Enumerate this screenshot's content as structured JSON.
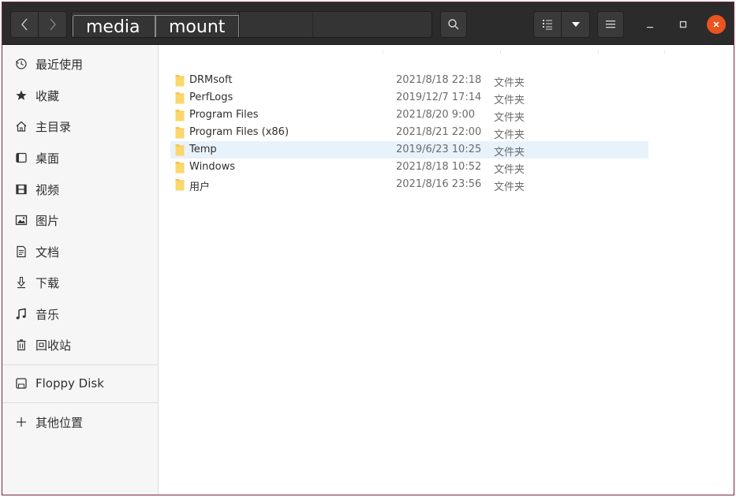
{
  "path": {
    "crumbs": [
      "media",
      "mount"
    ]
  },
  "sidebar": {
    "places": [
      {
        "label": "最近使用",
        "icon": "clock-icon"
      },
      {
        "label": "收藏",
        "icon": "star-icon"
      },
      {
        "label": "主目录",
        "icon": "home-icon"
      },
      {
        "label": "桌面",
        "icon": "desktop-icon"
      },
      {
        "label": "视频",
        "icon": "video-icon"
      },
      {
        "label": "图片",
        "icon": "image-icon"
      },
      {
        "label": "文档",
        "icon": "document-icon"
      },
      {
        "label": "下载",
        "icon": "download-icon"
      },
      {
        "label": "音乐",
        "icon": "music-icon"
      },
      {
        "label": "回收站",
        "icon": "trash-icon"
      }
    ],
    "devices": [
      {
        "label": "Floppy Disk",
        "icon": "floppy-icon"
      }
    ],
    "other": {
      "label": "其他位置",
      "icon": "plus-icon"
    }
  },
  "files": [
    {
      "name": "DRMsoft",
      "modified": "2021/8/18 22:18",
      "type": "文件夹"
    },
    {
      "name": "PerfLogs",
      "modified": "2019/12/7 17:14",
      "type": "文件夹"
    },
    {
      "name": "Program Files",
      "modified": "2021/8/20 9:00",
      "type": "文件夹"
    },
    {
      "name": "Program Files (x86)",
      "modified": "2021/8/21 22:00",
      "type": "文件夹"
    },
    {
      "name": "Temp",
      "modified": "2019/6/23 10:25",
      "type": "文件夹",
      "selected": true
    },
    {
      "name": "Windows",
      "modified": "2021/8/18 10:52",
      "type": "文件夹"
    },
    {
      "name": "用户",
      "modified": "2021/8/16 23:56",
      "type": "文件夹"
    }
  ],
  "colors": {
    "header_bg": "#2b2b2b",
    "close_button": "#e95420",
    "folder": "#f7c24c",
    "selection": "#e8f2fb",
    "window_border": "#7a1f40"
  }
}
